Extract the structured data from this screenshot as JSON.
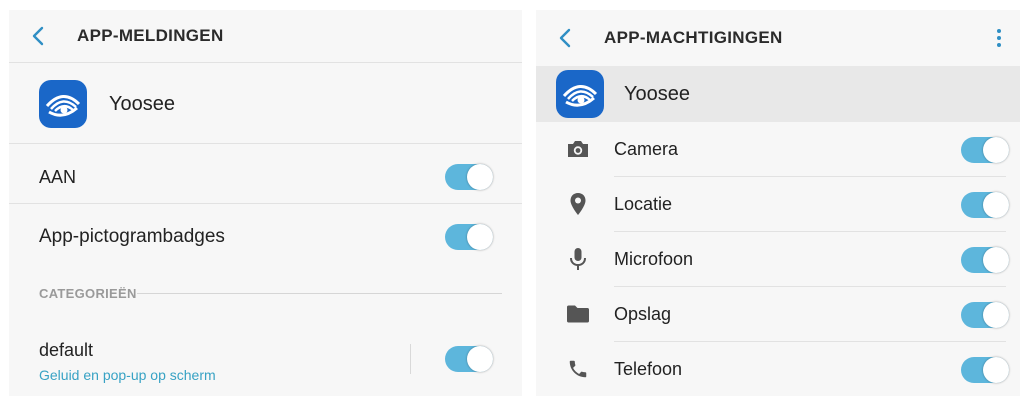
{
  "left": {
    "header": {
      "title": "APP-MELDINGEN",
      "back_icon": "chevron-left-icon"
    },
    "app": {
      "name": "Yoosee",
      "icon": "yoosee-eye-logo"
    },
    "settings": [
      {
        "label": "AAN",
        "enabled": true
      },
      {
        "label": "App-pictogrambadges",
        "enabled": true
      }
    ],
    "categories": {
      "heading": "CATEGORIEËN",
      "items": [
        {
          "label": "default",
          "sublabel": "Geluid en pop-up op scherm",
          "enabled": true
        }
      ]
    }
  },
  "right": {
    "header": {
      "title": "APP-MACHTIGINGEN",
      "back_icon": "chevron-left-icon",
      "menu_icon": "more-vert-icon"
    },
    "app": {
      "name": "Yoosee",
      "icon": "yoosee-eye-logo"
    },
    "permissions": [
      {
        "label": "Camera",
        "icon": "camera-icon",
        "enabled": true
      },
      {
        "label": "Locatie",
        "icon": "location-pin-icon",
        "enabled": true
      },
      {
        "label": "Microfoon",
        "icon": "microphone-icon",
        "enabled": true
      },
      {
        "label": "Opslag",
        "icon": "folder-icon",
        "enabled": true
      },
      {
        "label": "Telefoon",
        "icon": "phone-icon",
        "enabled": true
      }
    ]
  },
  "colors": {
    "accent": "#5db6dc",
    "link": "#37a2c4",
    "app_icon": "#1a67c8",
    "background": "#f7f7f7"
  }
}
